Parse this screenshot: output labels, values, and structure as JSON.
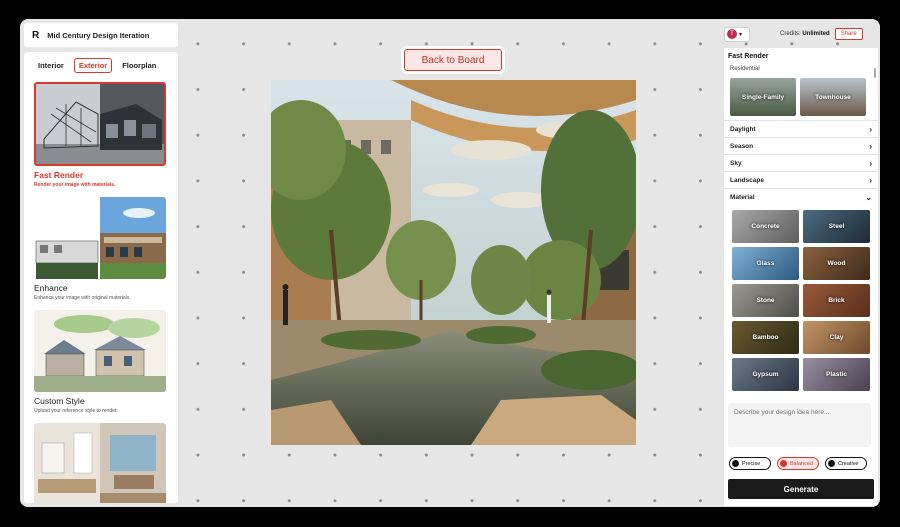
{
  "app": {
    "logo": "R",
    "title": "Mid Century Design Iteration"
  },
  "left_tabs": [
    {
      "label": "Interior",
      "active": false
    },
    {
      "label": "Exterior",
      "active": true
    },
    {
      "label": "Floorplan",
      "active": false
    }
  ],
  "options": [
    {
      "title": "Fast Render",
      "desc": "Render your image with materials.",
      "selected": true
    },
    {
      "title": "Enhance",
      "desc": "Enhance your image with original materials.",
      "selected": false
    },
    {
      "title": "Custom Style",
      "desc": "Upload your reference style to render.",
      "selected": false
    }
  ],
  "back_button": "Back to Board",
  "user": {
    "avatar_letter": "T",
    "credits_label": "Credits:",
    "credits_value": "Unlimited",
    "share": "Share"
  },
  "right_panel": {
    "title": "Fast Render",
    "residential_label": "Residential",
    "residential": [
      "Single-Family",
      "Townhouse"
    ],
    "accordion": [
      {
        "label": "Daylight",
        "expanded": false
      },
      {
        "label": "Season",
        "expanded": false
      },
      {
        "label": "Sky",
        "expanded": false
      },
      {
        "label": "Landscape",
        "expanded": false
      },
      {
        "label": "Material",
        "expanded": true
      }
    ],
    "materials": [
      "Concrete",
      "Steel",
      "Glass",
      "Wood",
      "Stone",
      "Brick",
      "Bamboo",
      "Clay",
      "Gypsum",
      "Plastic"
    ],
    "prompt_placeholder": "Describe your design idea here...",
    "modes": [
      {
        "label": "Precise",
        "active": false
      },
      {
        "label": "Balanced",
        "active": true
      },
      {
        "label": "Creative",
        "active": false
      }
    ],
    "generate": "Generate"
  },
  "colors": {
    "accent": "#d6392b",
    "canvas": "#e6e6e6",
    "dark_button": "#1a1a1a"
  }
}
